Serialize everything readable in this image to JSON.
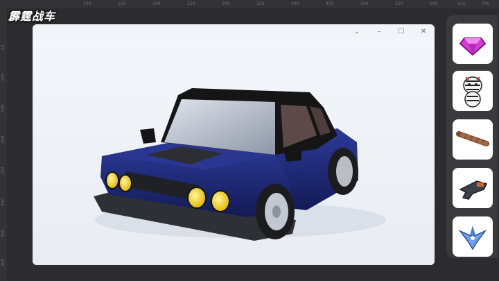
{
  "app": {
    "logo_text": "霹霆战车"
  },
  "ruler": {
    "top_ticks": [
      "100",
      "150",
      "200",
      "250",
      "300",
      "350",
      "400",
      "450",
      "500",
      "550",
      "600",
      "650",
      "700"
    ],
    "left_ticks": [
      "50",
      "100",
      "150",
      "200",
      "250",
      "300",
      "350",
      "400"
    ]
  },
  "window": {
    "controls": {
      "chevron": "⌄",
      "minimize": "–",
      "maximize": "☐",
      "close": "✕"
    }
  },
  "preview": {
    "subject": "blue-sedan-3d-model",
    "body_color": "#1d2b7a",
    "light_color": "#f2d21b"
  },
  "items": [
    {
      "name": "pink-gem-icon",
      "color": "#d63ad6"
    },
    {
      "name": "zebra-character-icon",
      "color": "#ffffff"
    },
    {
      "name": "brown-chain-icon",
      "color": "#7a4a2e"
    },
    {
      "name": "blaster-gun-icon",
      "color": "#3b3f48"
    },
    {
      "name": "blue-drone-icon",
      "color": "#4a7fd9"
    }
  ],
  "colors": {
    "background": "#2c2c2e",
    "window": "#f1f4f8",
    "panel": "#3a3a3d",
    "slot": "#ffffff"
  }
}
